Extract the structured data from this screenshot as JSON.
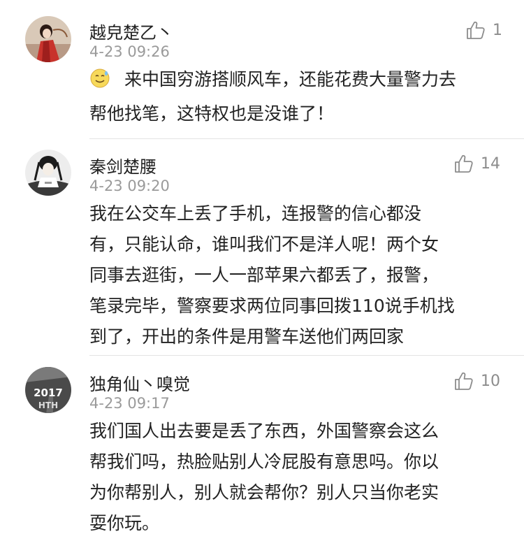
{
  "comments": [
    {
      "username": "越皃楚乙丶",
      "timestamp": "4-23 09:26",
      "likes": "1",
      "avatar_icon": "avatar-red-robed-figure",
      "emoji_icon": "sweat-smile-emoji-icon",
      "lines": [
        "来中国穷游搭顺风车，还能花费大量警力去",
        "帮他找笔，这特权也是没谁了！"
      ]
    },
    {
      "username": "秦剑楚腰",
      "timestamp": "4-23 09:20",
      "likes": "14",
      "avatar_icon": "avatar-ink-portrait",
      "lines": [
        "我在公交车上丢了手机，连报警的信心都没",
        "有，只能认命，谁叫我们不是洋人呢！两个女",
        "同事去逛街，一人一部苹果六都丢了，报警，",
        "笔录完毕，警察要求两位同事回拨110说手机找",
        "到了，开出的条件是用警车送他们两回家"
      ]
    },
    {
      "username": "独角仙丶嗅觉",
      "timestamp": "4-23 09:17",
      "likes": "10",
      "avatar_icon": "avatar-road-2017",
      "avatar_text": [
        "2017",
        "HTH"
      ],
      "lines": [
        "我们国人出去要是丢了东西，外国警察会这么",
        "帮我们吗，热脸贴别人冷屁股有意思吗。你以",
        "为你帮别人，别人就会帮你？别人只当你老实",
        "耍你玩。"
      ]
    }
  ],
  "colors": {
    "text": "#222222",
    "meta": "#9a9a9a",
    "like": "#8c8c8c",
    "divider": "#e4e4e4"
  }
}
